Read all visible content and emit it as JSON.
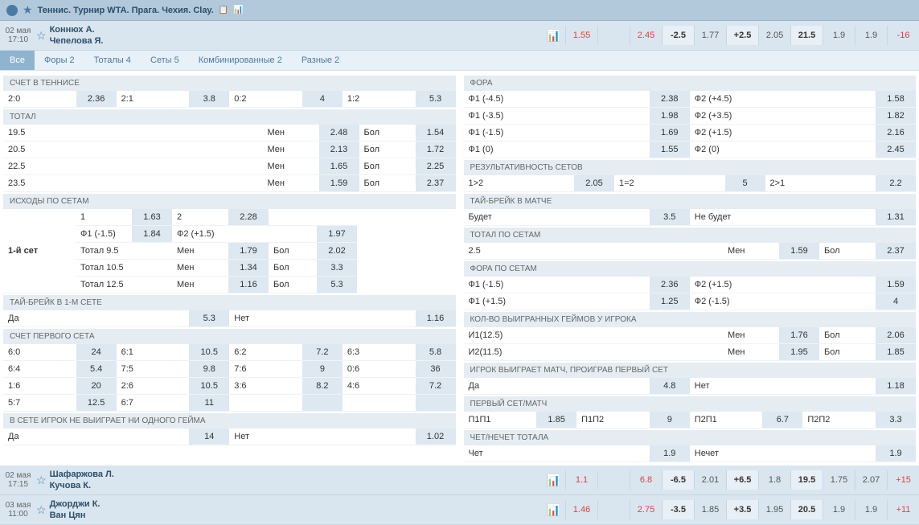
{
  "header": {
    "title": "Теннис. Турнир WTA. Прага. Чехия. Clay."
  },
  "main_match": {
    "date": "02 мая",
    "time": "17:10",
    "p1": "Коннюх А.",
    "p2": "Чепелова Я.",
    "odds": [
      "1.55",
      "",
      "2.45",
      "-2.5",
      "1.77",
      "+2.5",
      "2.05",
      "21.5",
      "1.9",
      "1.9",
      "-16"
    ]
  },
  "tabs": [
    {
      "l": "Все"
    },
    {
      "l": "Форы 2"
    },
    {
      "l": "Тоталы 4"
    },
    {
      "l": "Сеты 5"
    },
    {
      "l": "Комбинированные 2"
    },
    {
      "l": "Разные 2"
    }
  ],
  "tennis_score": {
    "h": "СЧЕТ В ТЕННИСЕ",
    "r": [
      [
        "2:0",
        "2.36",
        "2:1",
        "3.8",
        "0:2",
        "4",
        "1:2",
        "5.3"
      ]
    ]
  },
  "total": {
    "h": "ТОТАЛ",
    "r": [
      [
        "19.5",
        "Мен",
        "2.48",
        "Бол",
        "1.54"
      ],
      [
        "20.5",
        "Мен",
        "2.13",
        "Бол",
        "1.72"
      ],
      [
        "22.5",
        "Мен",
        "1.65",
        "Бол",
        "2.25"
      ],
      [
        "23.5",
        "Мен",
        "1.59",
        "Бол",
        "2.37"
      ]
    ]
  },
  "set_out": {
    "h": "ИСХОДЫ ПО СЕТАМ",
    "set": "1-й сет",
    "r": [
      [
        "1",
        "1.63",
        "2",
        "2.28",
        "",
        ""
      ],
      [
        "Ф1 (-1.5)",
        "1.84",
        "Ф2 (+1.5)",
        "",
        "",
        "1.97"
      ],
      [
        "Тотал 9.5",
        "",
        "Мен",
        "1.79",
        "Бол",
        "2.02"
      ],
      [
        "Тотал 10.5",
        "",
        "Мен",
        "1.34",
        "Бол",
        "3.3"
      ],
      [
        "Тотал 12.5",
        "",
        "Мен",
        "1.16",
        "Бол",
        "5.3"
      ]
    ]
  },
  "tb1": {
    "h": "ТАЙ-БРЕЙК В 1-М СЕТЕ",
    "r": [
      [
        "Да",
        "5.3",
        "Нет",
        "1.16"
      ]
    ]
  },
  "set1": {
    "h": "СЧЕТ ПЕРВОГО СЕТА",
    "r": [
      [
        "6:0",
        "24",
        "6:1",
        "10.5",
        "6:2",
        "7.2",
        "6:3",
        "5.8"
      ],
      [
        "6:4",
        "5.4",
        "7:5",
        "9.8",
        "7:6",
        "9",
        "0:6",
        "36"
      ],
      [
        "1:6",
        "20",
        "2:6",
        "10.5",
        "3:6",
        "8.2",
        "4:6",
        "7.2"
      ],
      [
        "5:7",
        "12.5",
        "6:7",
        "11",
        "",
        "",
        "",
        ""
      ]
    ]
  },
  "nogame": {
    "h": "В СЕТЕ ИГРОК НЕ ВЫИГРАЕТ НИ ОДНОГО ГЕЙМА",
    "r": [
      [
        "Да",
        "14",
        "Нет",
        "1.02"
      ]
    ]
  },
  "fora": {
    "h": "ФОРА",
    "r": [
      [
        "Ф1 (-4.5)",
        "2.38",
        "Ф2 (+4.5)",
        "1.58"
      ],
      [
        "Ф1 (-3.5)",
        "1.98",
        "Ф2 (+3.5)",
        "1.82"
      ],
      [
        "Ф1 (-1.5)",
        "1.69",
        "Ф2 (+1.5)",
        "2.16"
      ],
      [
        "Ф1 (0)",
        "1.55",
        "Ф2 (0)",
        "2.45"
      ]
    ]
  },
  "res_sets": {
    "h": "РЕЗУЛЬТАТИВНОСТЬ СЕТОВ",
    "r": [
      [
        "1>2",
        "2.05",
        "1=2",
        "5",
        "2>1",
        "2.2"
      ]
    ]
  },
  "tb_m": {
    "h": "ТАЙ-БРЕЙК В МАТЧЕ",
    "r": [
      [
        "Будет",
        "3.5",
        "Не будет",
        "1.31"
      ]
    ]
  },
  "tot_s": {
    "h": "ТОТАЛ ПО СЕТАМ",
    "r": [
      [
        "2.5",
        "Мен",
        "1.59",
        "Бол",
        "2.37"
      ]
    ]
  },
  "fora_s": {
    "h": "ФОРА ПО СЕТАМ",
    "r": [
      [
        "Ф1 (-1.5)",
        "2.36",
        "Ф2 (+1.5)",
        "1.59"
      ],
      [
        "Ф1 (+1.5)",
        "1.25",
        "Ф2 (-1.5)",
        "4"
      ]
    ]
  },
  "games": {
    "h": "КОЛ-ВО ВЫИГРАННЫХ ГЕЙМОВ У ИГРОКА",
    "r": [
      [
        "И1(12.5)",
        "Мен",
        "1.76",
        "Бол",
        "2.06"
      ],
      [
        "И2(11.5)",
        "Мен",
        "1.95",
        "Бол",
        "1.85"
      ]
    ]
  },
  "lose1": {
    "h": "ИГРОК ВЫИГРАЕТ МАТЧ, ПРОИГРАВ ПЕРВЫЙ СЕТ",
    "r": [
      [
        "Да",
        "4.8",
        "Нет",
        "1.18"
      ]
    ]
  },
  "fs_m": {
    "h": "ПЕРВЫЙ СЕТ/МАТЧ",
    "r": [
      [
        "П1П1",
        "1.85",
        "П1П2",
        "9",
        "П2П1",
        "6.7",
        "П2П2",
        "3.3"
      ]
    ]
  },
  "oe": {
    "h": "ЧЕТ/НЕЧЕТ ТОТАЛА",
    "r": [
      [
        "Чет",
        "1.9",
        "Нечет",
        "1.9"
      ]
    ]
  },
  "footer": [
    {
      "date": "02 мая",
      "time": "17:15",
      "p1": "Шафаржова Л.",
      "p2": "Кучова К.",
      "odds": [
        "1.1",
        "",
        "6.8",
        "-6.5",
        "2.01",
        "+6.5",
        "1.8",
        "19.5",
        "1.75",
        "2.07",
        "+15"
      ]
    },
    {
      "date": "03 мая",
      "time": "11:00",
      "p1": "Джорджи К.",
      "p2": "Ван Цян",
      "odds": [
        "1.46",
        "",
        "2.75",
        "-3.5",
        "1.85",
        "+3.5",
        "1.95",
        "20.5",
        "1.9",
        "1.9",
        "+11"
      ]
    }
  ]
}
